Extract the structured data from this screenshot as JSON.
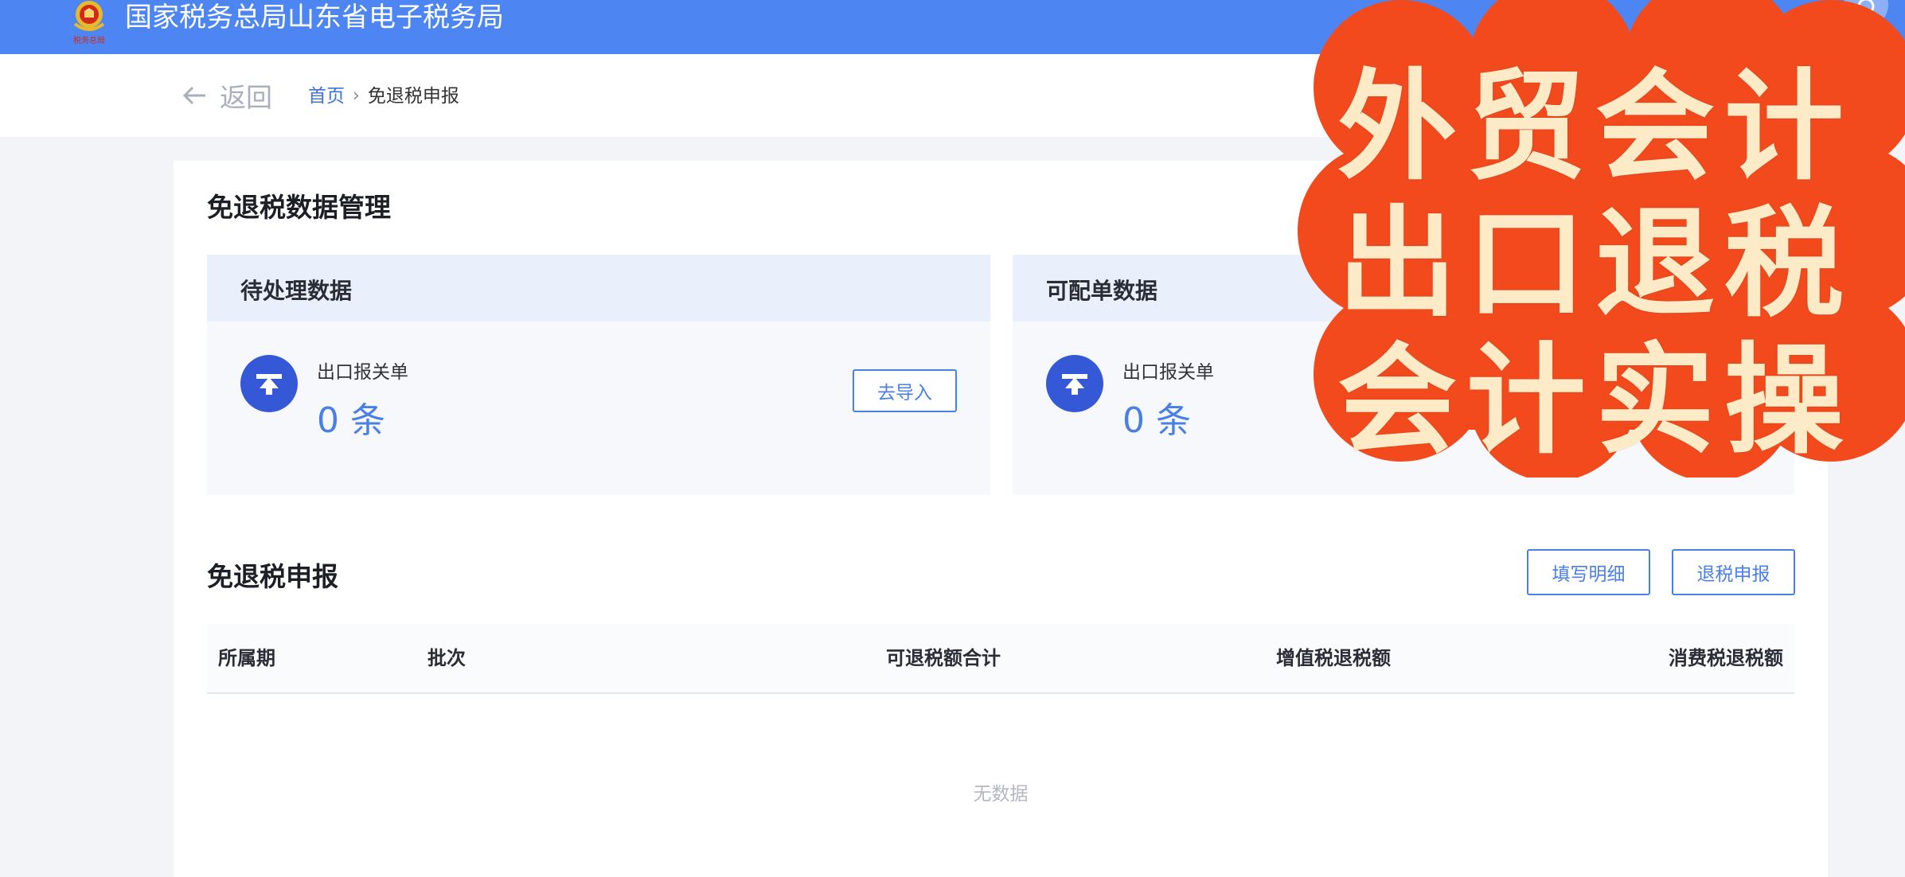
{
  "header": {
    "site_title": "国家税务总局山东省电子税务局",
    "emblem_caption": "税务总局"
  },
  "nav": {
    "back_label": "返回",
    "breadcrumb": {
      "home": "首页",
      "separator": "›",
      "current": "免退税申报"
    }
  },
  "data_management": {
    "title": "免退税数据管理",
    "panels": [
      {
        "title": "待处理数据",
        "item_label": "出口报关单",
        "count": "0 条",
        "button": "去导入"
      },
      {
        "title": "可配单数据",
        "item_label": "出口报关单",
        "count": "0 条"
      }
    ]
  },
  "declaration": {
    "title": "免退税申报",
    "buttons": {
      "fill_detail": "填写明细",
      "refund_declare": "退税申报"
    },
    "columns": [
      "所属期",
      "批次",
      "可退税额合计",
      "增值税退税额",
      "消费税退税额"
    ],
    "empty_text": "无数据"
  },
  "promo": {
    "lines": [
      "外贸会计",
      "出口退税",
      "会计实操"
    ],
    "bg_color": "#f24a1d",
    "text_color": "#fdebc8"
  },
  "colors": {
    "header_blue": "#4d86f2",
    "accent_blue": "#4a80e6",
    "icon_blue": "#3558d6"
  }
}
